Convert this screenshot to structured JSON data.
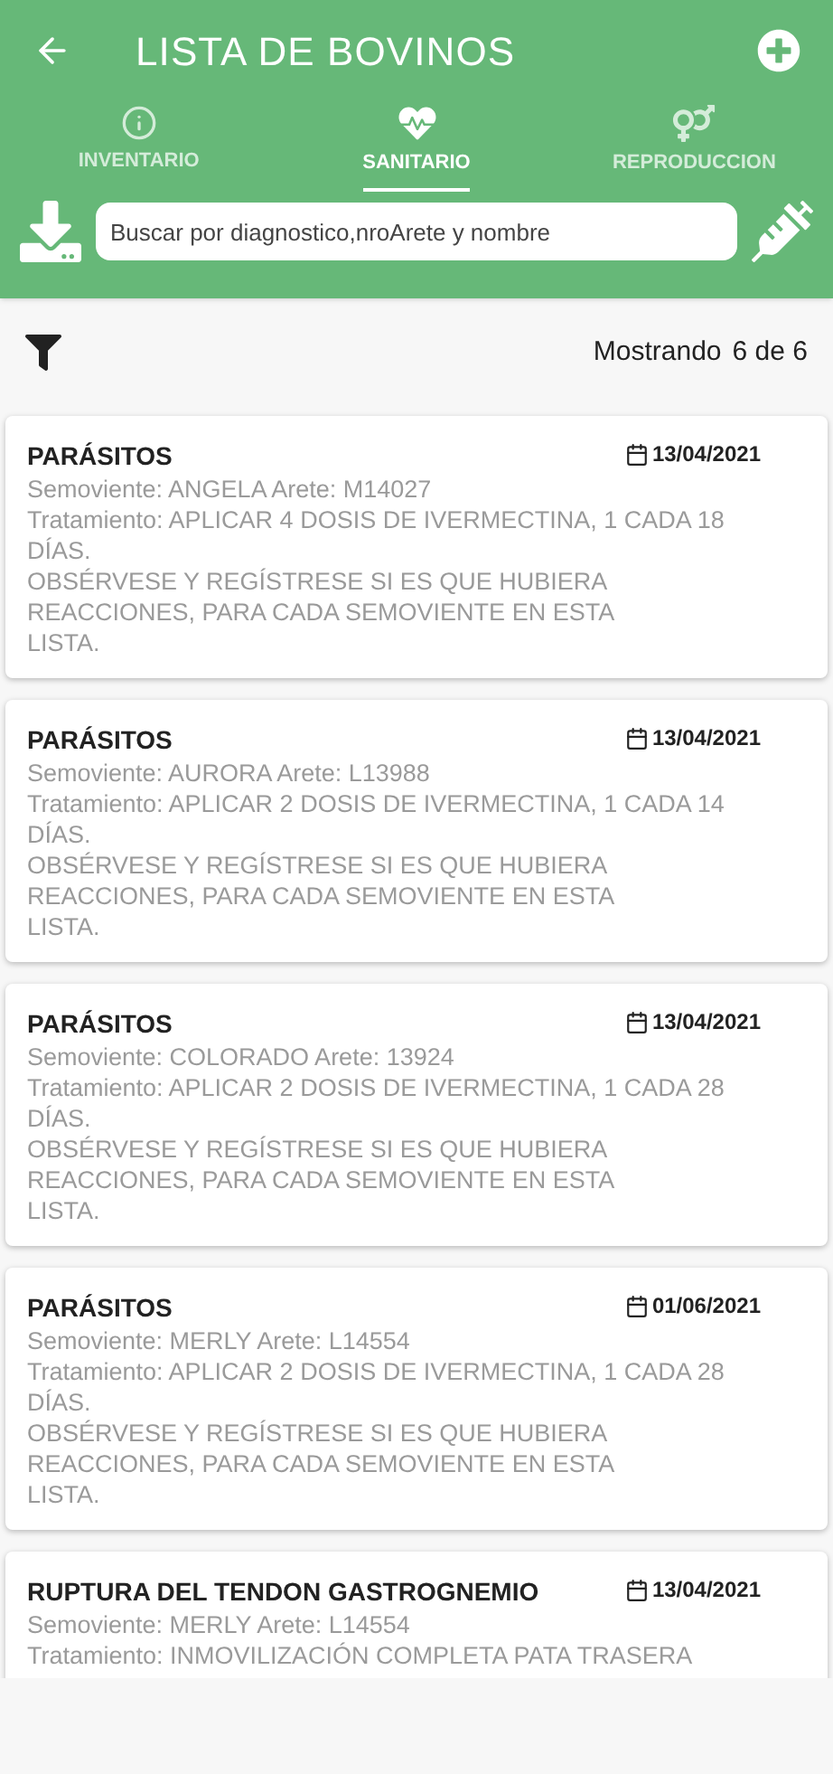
{
  "header": {
    "title": "LISTA DE BOVINOS"
  },
  "tabs": [
    {
      "label": "INVENTARIO",
      "kind": "info",
      "selected": false
    },
    {
      "label": "SANITARIO",
      "kind": "health",
      "selected": true
    },
    {
      "label": "REPRODUCCION",
      "kind": "gender",
      "selected": false
    }
  ],
  "search": {
    "placeholder": "Buscar por diagnostico,nroArete y nombre"
  },
  "count": {
    "label": "Mostrando",
    "value": "6 de 6"
  },
  "records": [
    {
      "diagnosis": "PARÁSITOS",
      "date": "13/04/2021",
      "animal": "Semoviente: ANGELA Arete: M14027",
      "treatment": "Tratamiento: APLICAR 4 DOSIS DE IVERMECTINA, 1 CADA 18 DÍAS.",
      "note": "OBSÉRVESE Y REGÍSTRESE SI ES QUE HUBIERA REACCIONES, PARA CADA SEMOVIENTE EN ESTA LISTA."
    },
    {
      "diagnosis": "PARÁSITOS",
      "date": "13/04/2021",
      "animal": "Semoviente: AURORA Arete: L13988",
      "treatment": "Tratamiento: APLICAR 2 DOSIS DE IVERMECTINA, 1 CADA 14 DÍAS.",
      "note": "OBSÉRVESE Y REGÍSTRESE SI ES QUE HUBIERA REACCIONES, PARA CADA SEMOVIENTE EN ESTA LISTA."
    },
    {
      "diagnosis": "PARÁSITOS",
      "date": "13/04/2021",
      "animal": "Semoviente: COLORADO Arete: 13924",
      "treatment": "Tratamiento: APLICAR 2 DOSIS DE IVERMECTINA, 1 CADA 28 DÍAS.",
      "note": "OBSÉRVESE Y REGÍSTRESE SI ES QUE HUBIERA REACCIONES, PARA CADA SEMOVIENTE EN ESTA LISTA."
    },
    {
      "diagnosis": "PARÁSITOS",
      "date": "01/06/2021",
      "animal": "Semoviente: MERLY Arete: L14554",
      "treatment": "Tratamiento: APLICAR 2 DOSIS DE IVERMECTINA, 1 CADA 28 DÍAS.",
      "note": "OBSÉRVESE Y REGÍSTRESE SI ES QUE HUBIERA REACCIONES, PARA CADA SEMOVIENTE EN ESTA LISTA."
    },
    {
      "diagnosis": "RUPTURA DEL TENDON GASTROGNEMIO",
      "date": "13/04/2021",
      "animal": "Semoviente: MERLY Arete: L14554",
      "treatment": "Tratamiento: INMOVILIZACIÓN COMPLETA PATA TRASERA"
    }
  ]
}
